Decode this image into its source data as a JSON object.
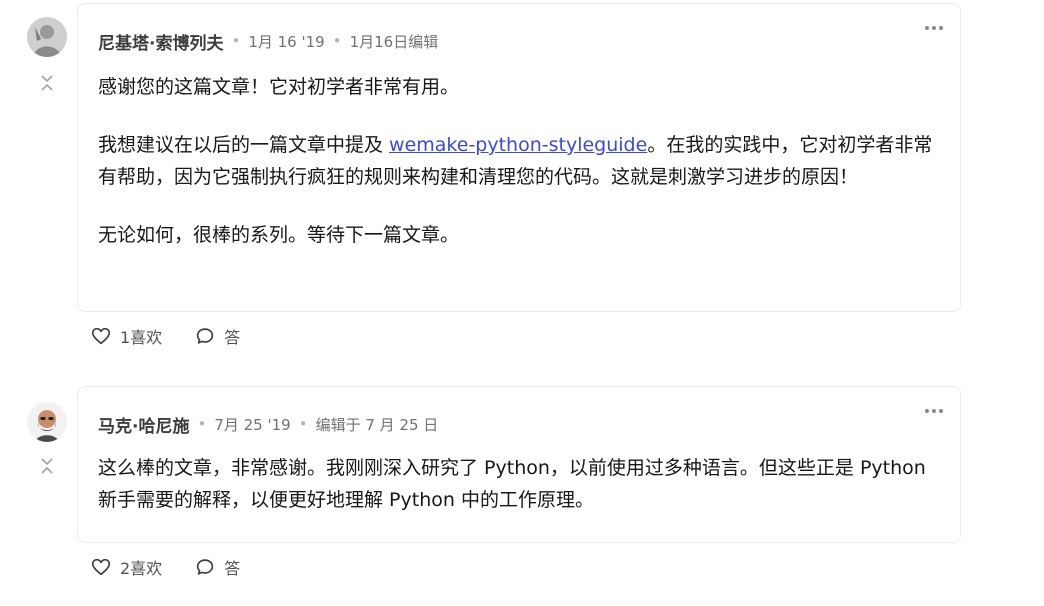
{
  "comments": [
    {
      "author": "尼基塔·索博列夫",
      "date": "1月 16 '19",
      "edited": "1月16日编辑",
      "paragraphs": [
        {
          "text": "感谢您的这篇文章！它对初学者非常有用。"
        },
        {
          "before": "我想建议在以后的一篇文章中提及 ",
          "link": "wemake-python-styleguide",
          "after": "。在我的实践中，它对初学者非常有帮助，因为它强制执行疯狂的规则来构建和清理您的代码。这就是刺激学习进步的原因！"
        },
        {
          "text": "无论如何，很棒的系列。等待下一篇文章。"
        }
      ],
      "likes": "1喜欢",
      "reply": "答"
    },
    {
      "author": "马克·哈尼施",
      "date": "7月 25 '19",
      "edited": "编辑于 7 月 25 日",
      "paragraphs": [
        {
          "text": "这么棒的文章，非常感谢。我刚刚深入研究了 Python，以前使用过多种语言。但这些正是 Python 新手需要的解释，以便更好地理解 Python 中的工作原理。"
        }
      ],
      "likes": "2喜欢",
      "reply": "答"
    }
  ],
  "icons": {
    "collapse": "collapse-arrows-icon",
    "more": "more-horizontal-icon",
    "heart": "heart-icon",
    "comment": "comment-bubble-icon"
  }
}
